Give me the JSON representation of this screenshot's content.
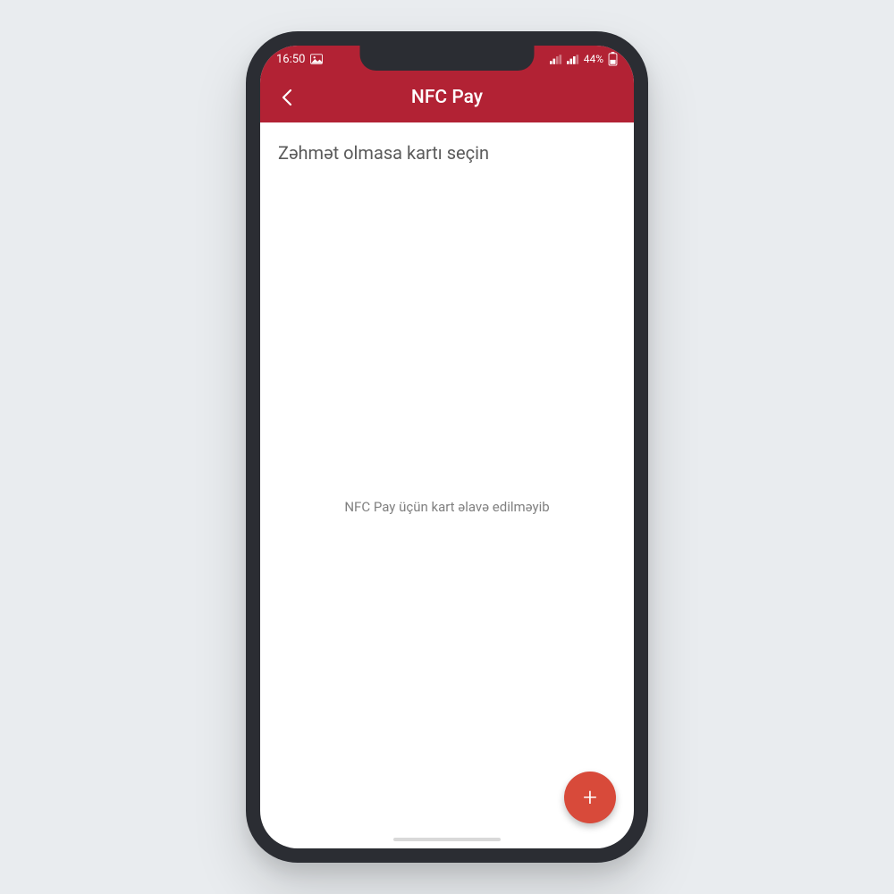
{
  "statusBar": {
    "time": "16:50",
    "battery": "44%"
  },
  "appBar": {
    "title": "NFC Pay"
  },
  "content": {
    "subtitle": "Zəhmət olmasa kartı seçin",
    "emptyMessage": "NFC Pay üçün kart əlavə edilməyib"
  },
  "colors": {
    "primary": "#b22234",
    "fab": "#d84a3a"
  }
}
